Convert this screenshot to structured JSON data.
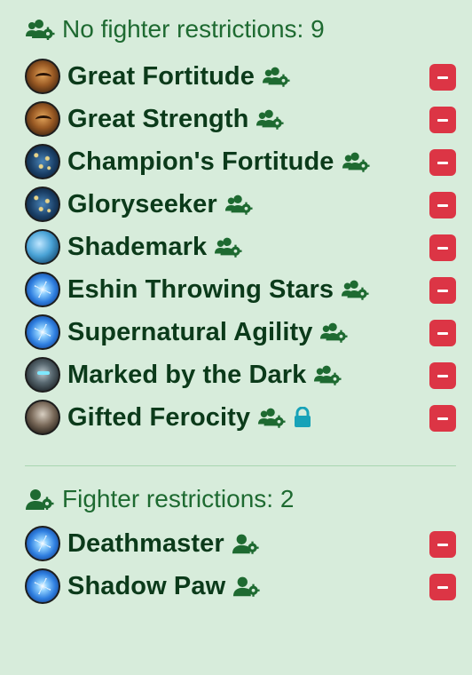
{
  "section1": {
    "title": "No fighter restrictions: 9",
    "icon": "users-gear-icon",
    "items": [
      {
        "name": "Great Fortitude",
        "avatar": "mask",
        "icon": "users-gear-icon",
        "locked": false
      },
      {
        "name": "Great Strength",
        "avatar": "mask",
        "icon": "users-gear-icon",
        "locked": false
      },
      {
        "name": "Champion's Fortitude",
        "avatar": "stars",
        "icon": "users-gear-icon",
        "locked": false
      },
      {
        "name": "Gloryseeker",
        "avatar": "stars",
        "icon": "users-gear-icon",
        "locked": false
      },
      {
        "name": "Shademark",
        "avatar": "shade",
        "icon": "users-gear-icon",
        "locked": false
      },
      {
        "name": "Eshin Throwing Stars",
        "avatar": "blue",
        "icon": "users-gear-icon",
        "locked": false
      },
      {
        "name": "Supernatural Agility",
        "avatar": "blue",
        "icon": "users-gear-icon",
        "locked": false
      },
      {
        "name": "Marked by the Dark",
        "avatar": "dark",
        "icon": "users-gear-icon",
        "locked": false
      },
      {
        "name": "Gifted Ferocity",
        "avatar": "beast",
        "icon": "users-gear-icon",
        "locked": true
      }
    ]
  },
  "section2": {
    "title": "Fighter restrictions: 2",
    "icon": "user-gear-icon",
    "items": [
      {
        "name": "Deathmaster",
        "avatar": "blue",
        "icon": "user-gear-icon",
        "locked": false
      },
      {
        "name": "Shadow Paw",
        "avatar": "blue",
        "icon": "user-gear-icon",
        "locked": false
      }
    ]
  },
  "colors": {
    "background": "#d7ecdb",
    "header_text": "#1e6a31",
    "item_text": "#0b3a1a",
    "remove_button": "#dc3545",
    "lock": "#17a2b8",
    "divider": "#a8d6b1"
  }
}
